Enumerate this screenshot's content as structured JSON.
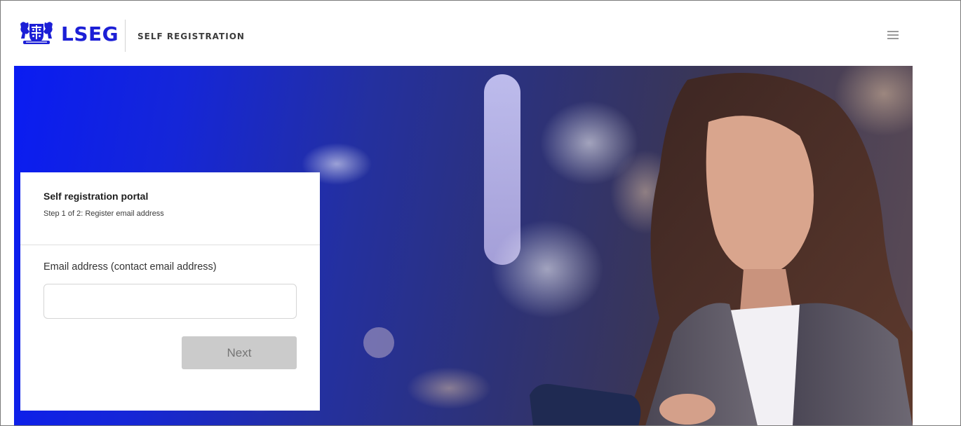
{
  "header": {
    "brand": "LSEG",
    "app_title": "SELF REGISTRATION",
    "brand_color": "#1c1fd6"
  },
  "card": {
    "title": "Self registration portal",
    "subtitle": "Step 1 of 2: Register email address",
    "email_label": "Email address (contact email address)",
    "email_value": "",
    "email_placeholder": "",
    "next_label": "Next"
  },
  "colors": {
    "hero_start": "#0a1cf2",
    "hero_end": "#5b4b55",
    "button_disabled": "#cbcbcb"
  },
  "icons": {
    "menu": "hamburger-menu-icon",
    "logo": "lseg-crest-icon"
  }
}
